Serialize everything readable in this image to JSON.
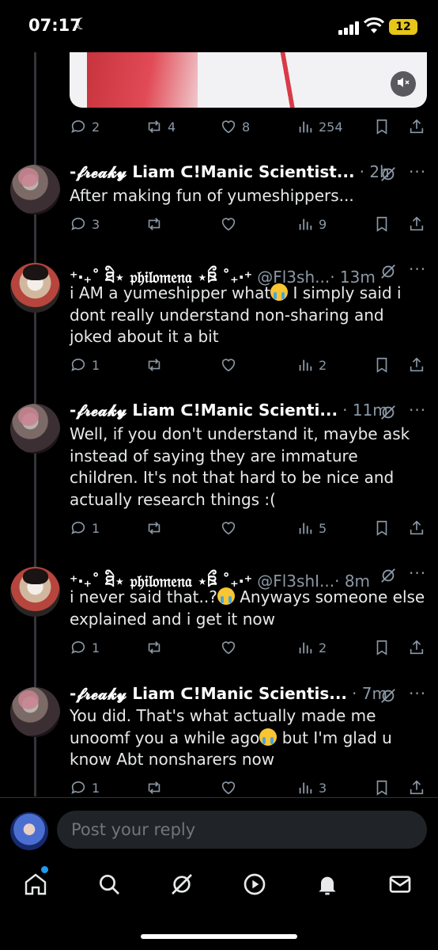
{
  "status": {
    "time": "07:17",
    "battery": "12"
  },
  "media": {
    "stats": {
      "replies": "2",
      "reposts": "4",
      "likes": "8",
      "views": "254"
    }
  },
  "tweets": [
    {
      "name": "-𝓯𝓻𝓮𝓪𝓴𝔂 Liam ᑕ!Manic Scientist...",
      "handle": "",
      "time": "· 2h",
      "text": "After making fun of yumeshippers...",
      "replies": "3",
      "reposts": "",
      "likes": "",
      "views": "9",
      "avatar": "liam"
    },
    {
      "name": "⁺‧₊˚ ཐི⋆ 𝔭𝔥𝔦𝔩𝔬𝔪𝔢𝔫𝔞 ⋆ཋྀ ˚₊‧⁺",
      "handle": "@Fl3sh...",
      "time": "· 13m",
      "text_parts": [
        "i AM a yumeshipper what",
        " I simply said i dont really understand non-sharing and joked about it a bit"
      ],
      "replies": "1",
      "reposts": "",
      "likes": "",
      "views": "2",
      "avatar": "philomena"
    },
    {
      "name": "-𝓯𝓻𝓮𝓪𝓴𝔂 Liam ᑕ!Manic Scienti...",
      "handle": "",
      "time": "· 11m",
      "text": "Well, if you don't understand it, maybe ask instead of saying they are immature children. It's not that hard to be nice and actually research things :(",
      "replies": "1",
      "reposts": "",
      "likes": "",
      "views": "5",
      "avatar": "liam"
    },
    {
      "name": "⁺‧₊˚ ཐི⋆ 𝔭𝔥𝔦𝔩𝔬𝔪𝔢𝔫𝔞 ⋆ཋྀ ˚₊‧⁺",
      "handle": "@Fl3shI...",
      "time": "· 8m",
      "text_parts": [
        "i never said that..?",
        " Anyways someone else explained and i get it now"
      ],
      "replies": "1",
      "reposts": "",
      "likes": "",
      "views": "2",
      "avatar": "philomena"
    },
    {
      "name": "-𝓯𝓻𝓮𝓪𝓴𝔂 Liam ᑕ!Manic Scientis...",
      "handle": "",
      "time": "· 7m",
      "text_parts": [
        "You did. That's what actually made me unoomf you a while ago",
        " but I'm glad u know Abt nonsharers now"
      ],
      "replies": "1",
      "reposts": "",
      "likes": "",
      "views": "3",
      "avatar": "liam"
    }
  ],
  "reply_box": {
    "placeholder": "Post your reply"
  },
  "icons": {
    "reply": "speech-bubble-icon",
    "repost": "repost-arrows-icon",
    "like": "heart-icon",
    "views": "bar-chart-icon",
    "bookmark": "bookmark-icon",
    "share": "share-upload-icon",
    "grok": "grok-slash-icon",
    "more": "more-dots-icon",
    "emoji": "loudly-crying-face-emoji"
  },
  "colors": {
    "background": "#000000",
    "text": "#e7e9ea",
    "muted": "#8b98a5",
    "accent": "#1d9bf0"
  }
}
